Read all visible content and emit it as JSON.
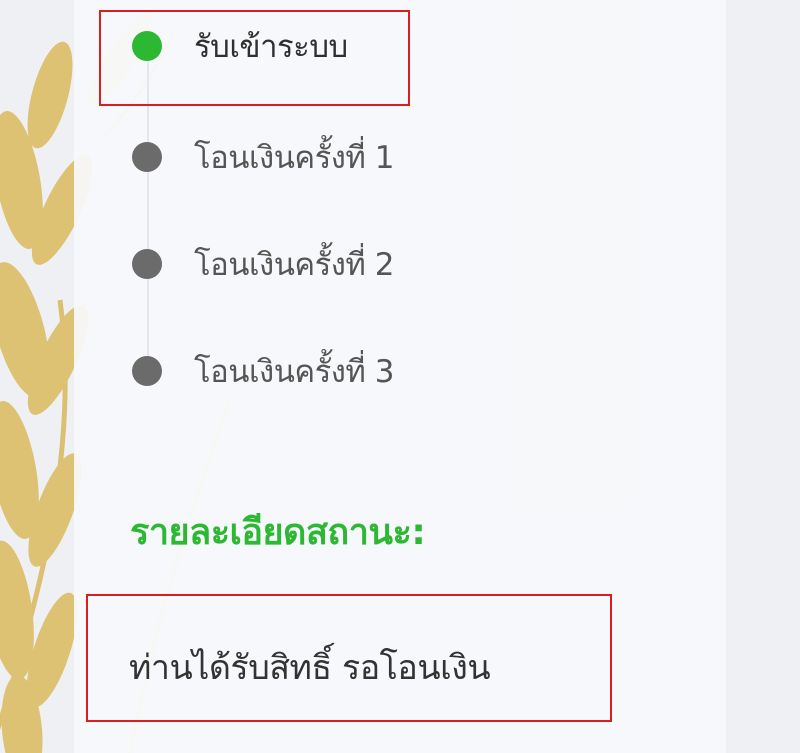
{
  "steps": [
    {
      "label": "รับเข้าระบบ",
      "status": "active"
    },
    {
      "label": "โอนเงินครั้งที่ 1",
      "status": "pending"
    },
    {
      "label": "โอนเงินครั้งที่ 2",
      "status": "pending"
    },
    {
      "label": "โอนเงินครั้งที่ 3",
      "status": "pending"
    }
  ],
  "status_section": {
    "heading": "รายละเอียดสถานะ:",
    "value": "ท่านได้รับสิทธิ์ รอโอนเงิน"
  },
  "colors": {
    "active_dot": "#2db833",
    "pending_dot": "#6b6b6b",
    "heading": "#2db833",
    "highlight_border": "#d81e1e"
  },
  "icons": {
    "background": "wheat-icon"
  }
}
